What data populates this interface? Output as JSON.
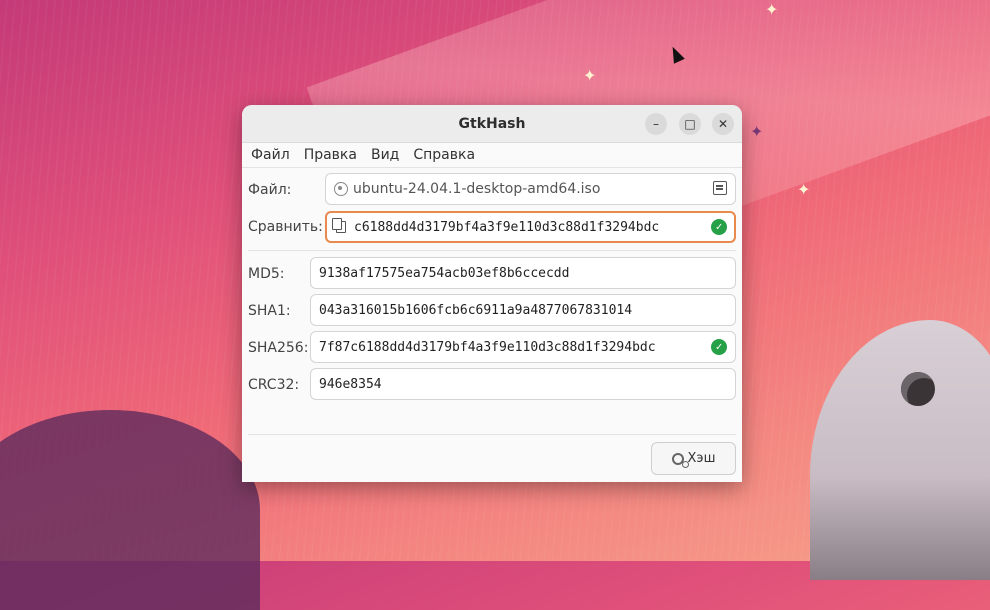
{
  "window": {
    "title": "GtkHash",
    "controls": {
      "minimize": "–",
      "maximize": "□",
      "close": "✕"
    }
  },
  "menu": [
    "Файл",
    "Правка",
    "Вид",
    "Справка"
  ],
  "file": {
    "label": "Файл:",
    "value": "ubuntu-24.04.1-desktop-amd64.iso"
  },
  "compare": {
    "label": "Сравнить:",
    "value": "c6188dd4d3179bf4a3f9e110d3c88d1f3294bdc",
    "match": true
  },
  "hashes": [
    {
      "label": "MD5:",
      "value": "9138af17575ea754acb03ef8b6ccecdd",
      "match": false
    },
    {
      "label": "SHA1:",
      "value": "043a316015b1606fcb6c6911a9a4877067831014",
      "match": false
    },
    {
      "label": "SHA256:",
      "value": "7f87c6188dd4d3179bf4a3f9e110d3c88d1f3294bdc",
      "match": true
    },
    {
      "label": "CRC32:",
      "value": "946e8354",
      "match": false
    }
  ],
  "hash_button": {
    "label": "Хэш"
  },
  "colors": {
    "match": "#26a148",
    "focus_border": "#e88a4c"
  },
  "icons": {
    "file_type": "disc-icon",
    "file_open": "document-open-icon",
    "compare": "paste-icon",
    "match": "check-circle-icon",
    "hash_button": "gear-icon"
  }
}
